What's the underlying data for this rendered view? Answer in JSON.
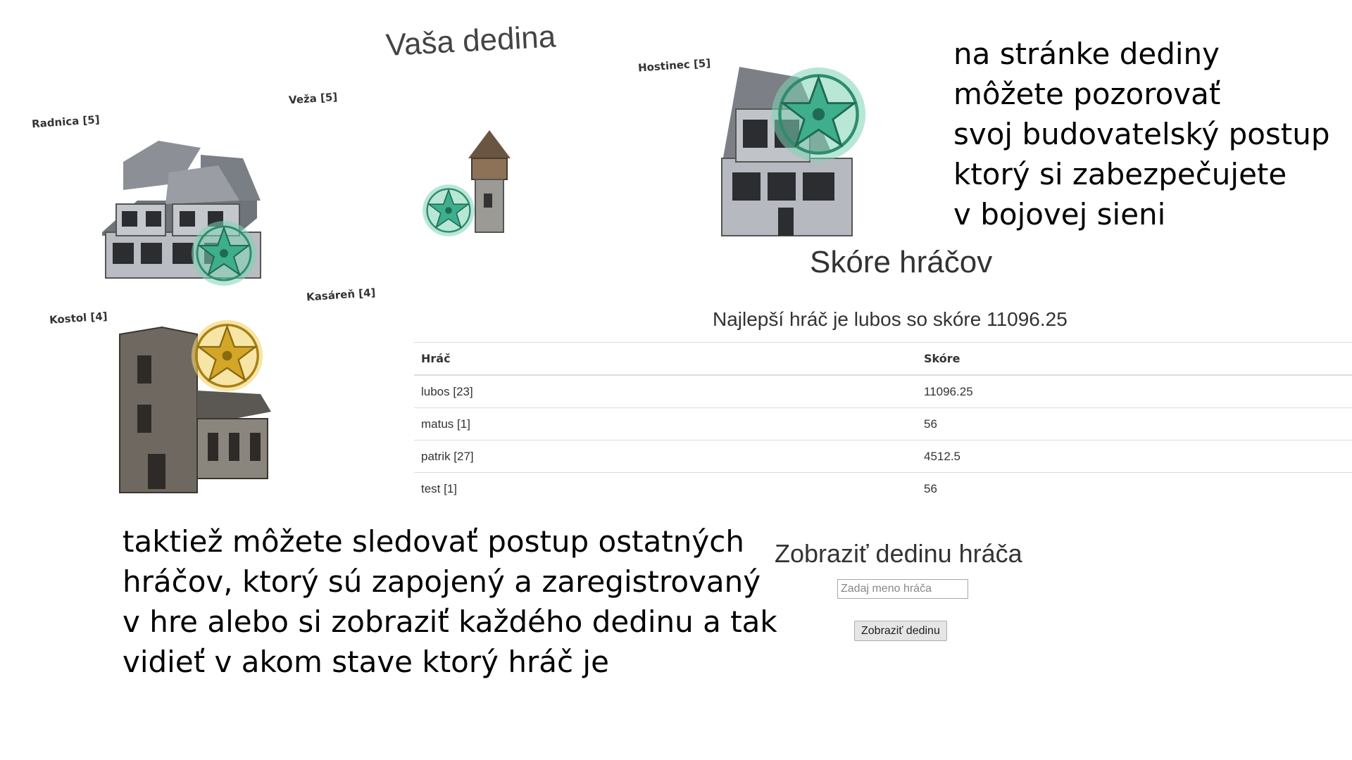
{
  "village": {
    "title": "Vaša dedina",
    "buildings": [
      {
        "id": "radnica",
        "label": "Radnica [5]",
        "star": "teal-star-icon"
      },
      {
        "id": "veza",
        "label": "Veža [5]",
        "star": "teal-star-icon"
      },
      {
        "id": "hostinec",
        "label": "Hostinec [5]",
        "star": "teal-star-icon"
      },
      {
        "id": "kostol",
        "label": "Kostol [4]",
        "star": "gold-star-icon"
      },
      {
        "id": "kasaren",
        "label": "Kasáreň [4]",
        "star": ""
      }
    ]
  },
  "caption_top": [
    "na stránke dediny",
    "môžete pozorovať",
    "svoj budovatelský postup",
    "ktorý si zabezpečujete",
    "v bojovej sieni"
  ],
  "score": {
    "title": "Skóre hráčov",
    "best_player": "Najlepší hráč je lubos so skóre 11096.25",
    "columns": [
      "Hráč",
      "Skóre"
    ],
    "rows": [
      {
        "player": "lubos [23]",
        "score": "11096.25"
      },
      {
        "player": "matus [1]",
        "score": "56"
      },
      {
        "player": "patrik [27]",
        "score": "4512.5"
      },
      {
        "player": "test [1]",
        "score": "56"
      }
    ]
  },
  "show_village": {
    "title": "Zobraziť dedinu hráča",
    "input_placeholder": "Zadaj meno hráča",
    "input_value": "",
    "button_label": "Zobraziť dedinu"
  },
  "caption_bottom": [
    "taktiež môžete sledovať postup ostatných",
    "hráčov, ktorý sú zapojený a zaregistrovaný",
    "v hre alebo si zobraziť každého dedinu a tak",
    "vidieť v akom stave ktorý hráč je"
  ],
  "colors": {
    "teal_star": "#3fae8c",
    "gold_star": "#d4a628",
    "table_border": "#dddddd"
  }
}
